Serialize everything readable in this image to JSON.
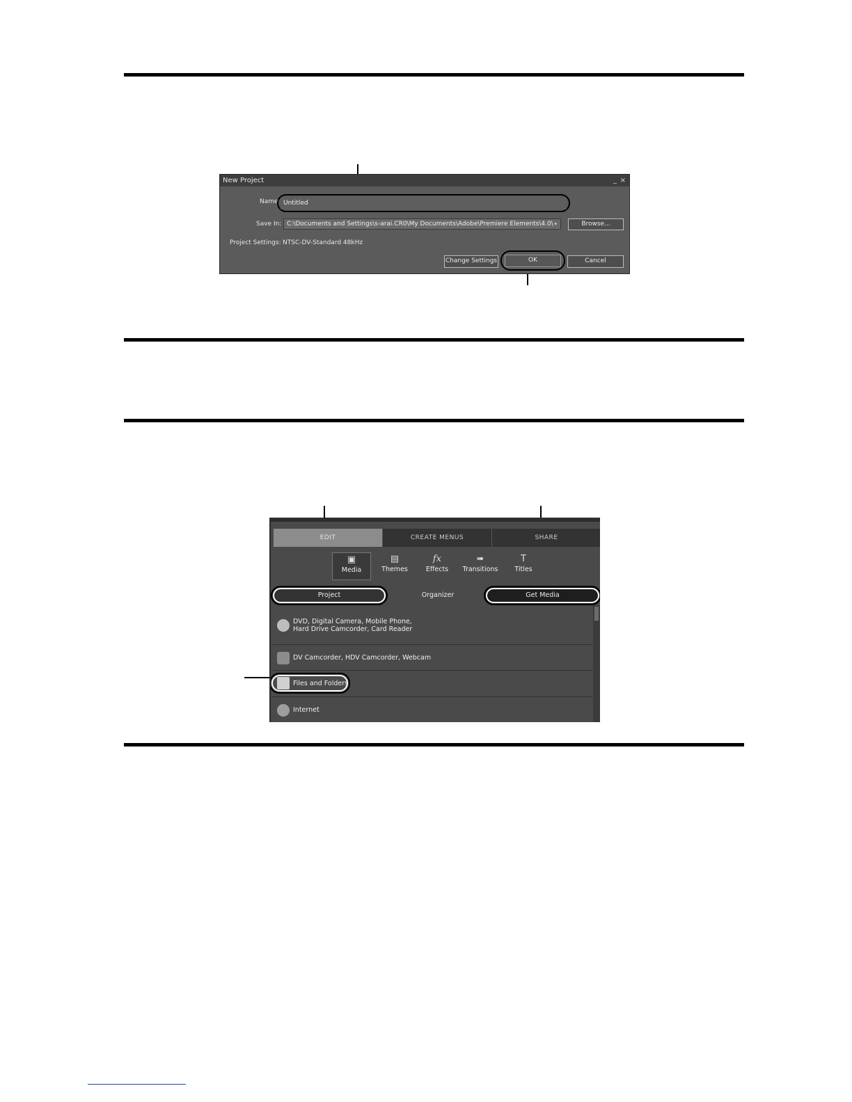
{
  "new_project_dialog": {
    "title": "New Project",
    "minimize_glyph": "_",
    "close_glyph": "×",
    "name_label": "Name",
    "name_value": "Untitled",
    "save_in_label": "Save In:",
    "save_in_value": "C:\\Documents and Settings\\s-arai.CR0\\My Documents\\Adobe\\Premiere Elements\\4.0\\",
    "browse_label": "Browse...",
    "project_settings_label": "Project Settings:",
    "project_settings_value": "NTSC-DV-Standard 48kHz",
    "change_settings_label": "Change Settings",
    "ok_label": "OK",
    "cancel_label": "Cancel"
  },
  "premiere_panel": {
    "tabs": [
      {
        "label": "EDIT",
        "active": true
      },
      {
        "label": "CREATE MENUS",
        "active": false
      },
      {
        "label": "SHARE",
        "active": false
      }
    ],
    "tools": [
      {
        "label": "Media",
        "icon": "media-icon",
        "active": true
      },
      {
        "label": "Themes",
        "icon": "themes-icon",
        "active": false
      },
      {
        "label": "Effects",
        "icon": "effects-icon",
        "glyph": "fx",
        "active": false
      },
      {
        "label": "Transitions",
        "icon": "transitions-icon",
        "active": false
      },
      {
        "label": "Titles",
        "icon": "titles-icon",
        "active": false
      }
    ],
    "subtabs": {
      "project": "Project",
      "organizer": "Organizer",
      "get_media": "Get Media"
    },
    "sources": [
      {
        "line1": "DVD, Digital Camera, Mobile Phone,",
        "line2": "Hard Drive Camcorder, Card Reader",
        "icon": "disc-camera-icon"
      },
      {
        "line1": "DV Camcorder, HDV Camcorder, Webcam",
        "line2": "",
        "icon": "camcorder-icon"
      },
      {
        "line1": "Files and Folders",
        "line2": "",
        "icon": "files-icon"
      },
      {
        "line1": "Internet",
        "line2": "",
        "icon": "globe-icon"
      }
    ]
  }
}
